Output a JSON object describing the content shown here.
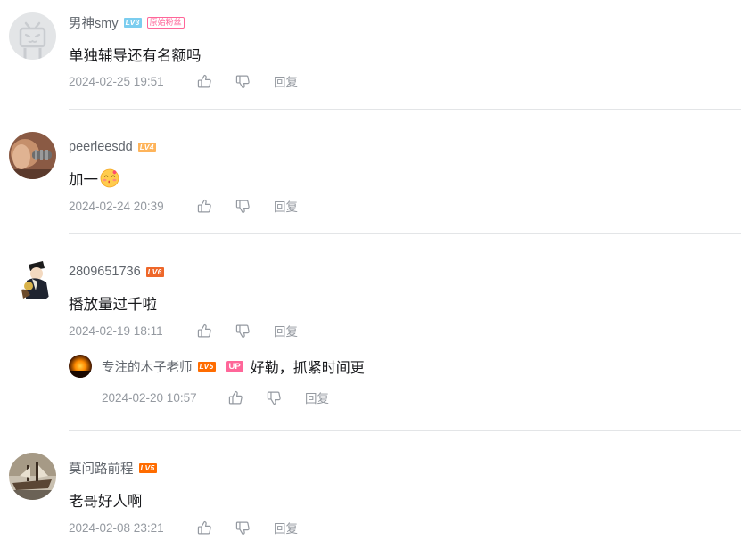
{
  "comments": [
    {
      "username": "男神smy",
      "level": "LV3",
      "badge": "原始粉丝",
      "text": "单独辅导还有名额吗",
      "time": "2024-02-25 19:51",
      "reply_label": "回复",
      "avatar": "bilibili-default-avatar"
    },
    {
      "username": "peerleesdd",
      "level": "LV4",
      "text": "加一",
      "emoji": "kiss-emoji",
      "time": "2024-02-24 20:39",
      "reply_label": "回复",
      "avatar": "photo-avatar"
    },
    {
      "username": "2809651736",
      "level": "LV6",
      "text": "播放量过千啦",
      "time": "2024-02-19 18:11",
      "reply_label": "回复",
      "avatar": "anime-avatar",
      "sub_reply": {
        "username": "专注的木子老师",
        "level": "LV5",
        "up_badge": "UP",
        "text": "好勒，抓紧时间更",
        "time": "2024-02-20 10:57",
        "reply_label": "回复",
        "avatar": "sunset-avatar"
      }
    },
    {
      "username": "莫问路前程",
      "level": "LV5",
      "text": "老哥好人啊",
      "time": "2024-02-08 23:21",
      "reply_label": "回复",
      "avatar": "ship-avatar"
    }
  ],
  "colors": {
    "username": "#61666d",
    "meta": "#9499a0",
    "lv3": "#7bcdef",
    "lv4": "#feb45b",
    "lv5": "#ff6c00",
    "lv6": "#ee672a",
    "up_badge": "#ff6699",
    "divider": "#e3e5e7"
  },
  "icons": {
    "like": "thumbs-up-icon",
    "dislike": "thumbs-down-icon"
  }
}
